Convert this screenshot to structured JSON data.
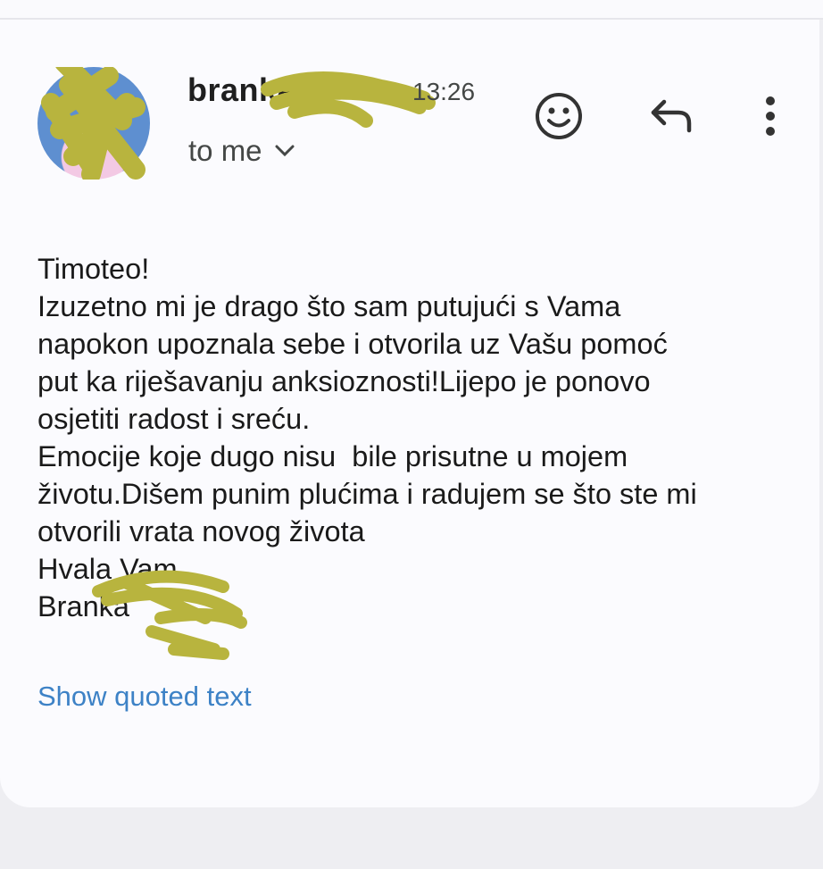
{
  "sender": {
    "name": "branka",
    "time": "13:26",
    "recipient_label": "to me"
  },
  "icons": {
    "avatar": "profile-photo",
    "expand": "chevron-down-icon",
    "react": "smiley-icon",
    "reply": "reply-arrow-icon",
    "more": "more-vert-icon"
  },
  "message": {
    "lines": [
      "Timoteo!",
      "Izuzetno mi je drago što sam putujući s Vama",
      "napokon upoznala sebe i otvorila uz Vašu pomoć",
      "put ka riješavanju anksioznosti!Lijepo je ponovo",
      "osjetiti radost i sreću.",
      "Emocije koje dugo nisu  bile prisutne u mojem",
      "životu.Dišem punim plućima i radujem se što ste mi",
      "otvorili vrata novog života",
      "Hvala Vam",
      "Branka"
    ]
  },
  "show_quoted_label": "Show quoted text",
  "colors": {
    "link": "#3d82c6",
    "redaction": "#b8b43e",
    "icon": "#444746"
  }
}
